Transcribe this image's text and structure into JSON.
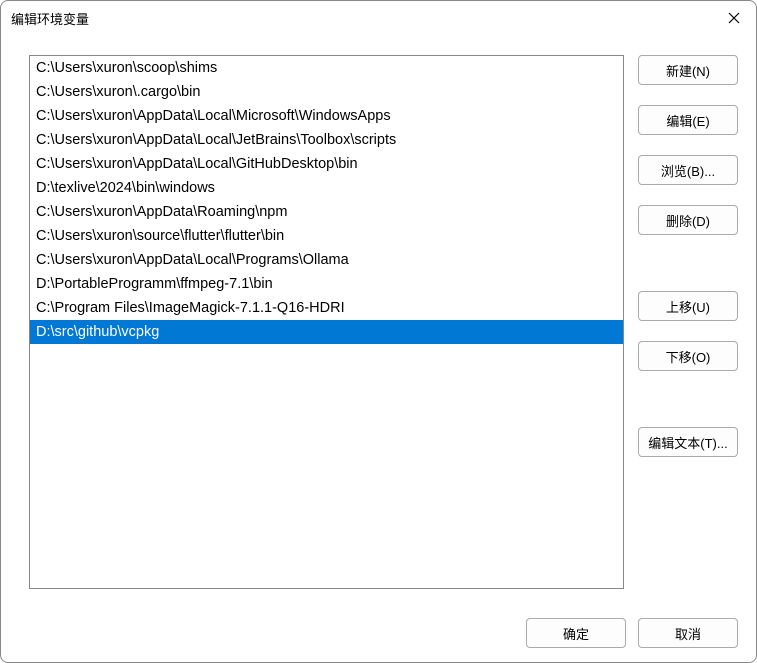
{
  "title": "编辑环境变量",
  "list": {
    "items": [
      "C:\\Users\\xuron\\scoop\\shims",
      "C:\\Users\\xuron\\.cargo\\bin",
      "C:\\Users\\xuron\\AppData\\Local\\Microsoft\\WindowsApps",
      "C:\\Users\\xuron\\AppData\\Local\\JetBrains\\Toolbox\\scripts",
      "C:\\Users\\xuron\\AppData\\Local\\GitHubDesktop\\bin",
      "D:\\texlive\\2024\\bin\\windows",
      "C:\\Users\\xuron\\AppData\\Roaming\\npm",
      "C:\\Users\\xuron\\source\\flutter\\flutter\\bin",
      "C:\\Users\\xuron\\AppData\\Local\\Programs\\Ollama",
      "D:\\PortableProgramm\\ffmpeg-7.1\\bin",
      "C:\\Program Files\\ImageMagick-7.1.1-Q16-HDRI",
      "D:\\src\\github\\vcpkg"
    ],
    "selected_index": 11
  },
  "buttons": {
    "new": "新建(N)",
    "edit": "编辑(E)",
    "browse": "浏览(B)...",
    "delete": "删除(D)",
    "move_up": "上移(U)",
    "move_down": "下移(O)",
    "edit_text": "编辑文本(T)...",
    "ok": "确定",
    "cancel": "取消"
  }
}
